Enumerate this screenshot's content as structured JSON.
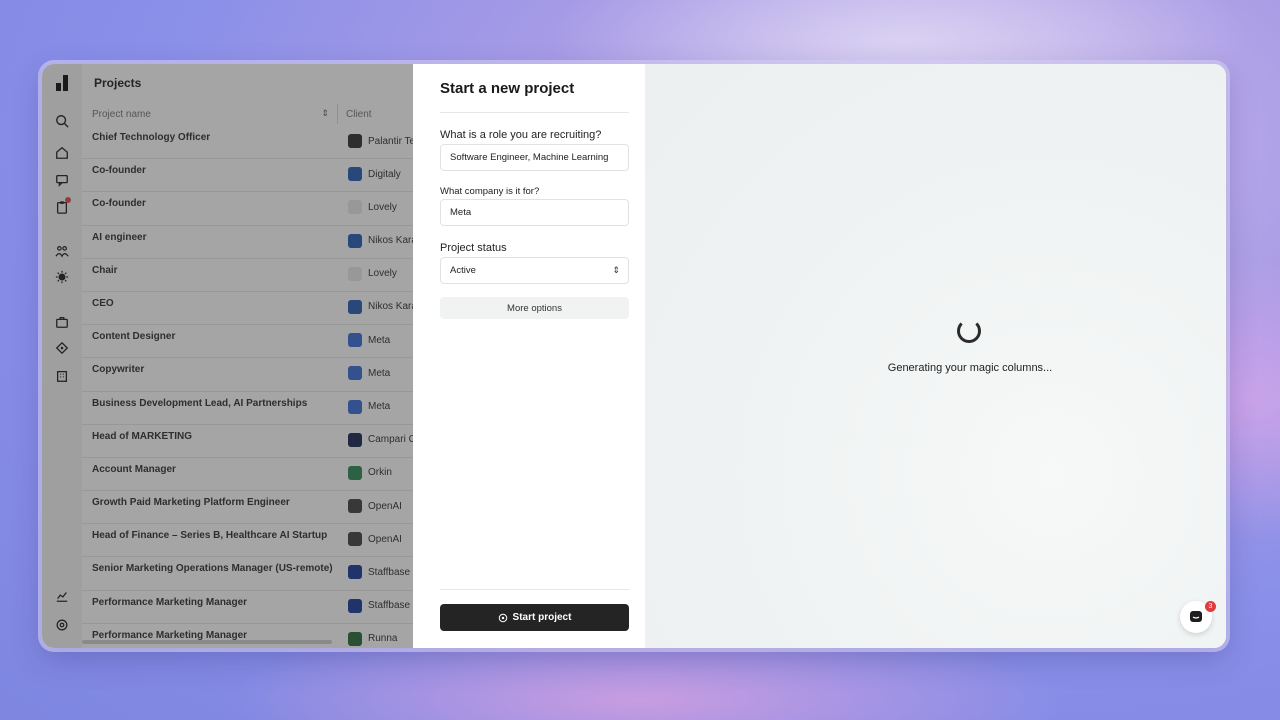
{
  "projects_page": {
    "title": "Projects",
    "columns": [
      "Project name",
      "Client"
    ],
    "rows": [
      {
        "name": "Chief Technology Officer",
        "client": "Palantir Te",
        "logo_color": "#333333",
        "logo_icon": "palantir-logo"
      },
      {
        "name": "Co-founder",
        "client": "Digitaly",
        "logo_color": "#2a5fb5",
        "logo_icon": "linkedin-logo"
      },
      {
        "name": "Co-founder",
        "client": "Lovely",
        "logo_color": "#e9e9e9",
        "logo_icon": "lovely-logo"
      },
      {
        "name": "AI engineer",
        "client": "Nikos Kara",
        "logo_color": "#2a5fb5",
        "logo_icon": "linkedin-logo"
      },
      {
        "name": "Chair",
        "client": "Lovely",
        "logo_color": "#e9e9e9",
        "logo_icon": "lovely-logo"
      },
      {
        "name": "CEO",
        "client": "Nikos Kara",
        "logo_color": "#2a5fb5",
        "logo_icon": "linkedin-logo"
      },
      {
        "name": "Content Designer",
        "client": "Meta",
        "logo_color": "#3b6fd8",
        "logo_icon": "meta-logo"
      },
      {
        "name": "Copywriter",
        "client": "Meta",
        "logo_color": "#3b6fd8",
        "logo_icon": "meta-logo"
      },
      {
        "name": "Business Development Lead, AI Partnerships",
        "client": "Meta",
        "logo_color": "#3b6fd8",
        "logo_icon": "meta-logo"
      },
      {
        "name": "Head of MARKETING",
        "client": "Campari G",
        "logo_color": "#1c2a55",
        "logo_icon": "campari-logo"
      },
      {
        "name": "Account Manager",
        "client": "Orkin",
        "logo_color": "#2f8a56",
        "logo_icon": "orkin-logo"
      },
      {
        "name": "Growth Paid Marketing Platform Engineer",
        "client": "OpenAI",
        "logo_color": "#444444",
        "logo_icon": "openai-logo"
      },
      {
        "name": "Head of Finance – Series B, Healthcare AI Startup",
        "client": "OpenAI",
        "logo_color": "#444444",
        "logo_icon": "openai-logo"
      },
      {
        "name": "Senior Marketing Operations Manager (US-remote)",
        "client": "Staffbase",
        "logo_color": "#1b3c9c",
        "logo_icon": "staffbase-logo"
      },
      {
        "name": "Performance Marketing Manager",
        "client": "Staffbase",
        "logo_color": "#1b3c9c",
        "logo_icon": "staffbase-logo"
      },
      {
        "name": "Performance Marketing Manager",
        "client": "Runna",
        "logo_color": "#2d6b3c",
        "logo_icon": "runna-logo"
      }
    ]
  },
  "sidebar": {
    "icons": [
      "logo-icon",
      "search-icon",
      "home-icon",
      "chat-icon",
      "clipboard-icon",
      "team-icon",
      "projects-icon",
      "briefcase-icon",
      "tag-icon",
      "building-icon",
      "analytics-icon",
      "settings-icon"
    ]
  },
  "form": {
    "title": "Start a new project",
    "role_label": "What is a role you are recruiting?",
    "role_value": "Software Engineer, Machine Learning",
    "company_label": "What company is it for?",
    "company_value": "Meta",
    "status_label": "Project status",
    "status_value": "Active",
    "more_options": "More options",
    "start_button": "Start project"
  },
  "generation": {
    "message": "Generating your magic columns..."
  },
  "chat": {
    "badge_count": "3"
  },
  "colors": {
    "primary_dark": "#242424",
    "badge_red": "#e23b3b"
  }
}
